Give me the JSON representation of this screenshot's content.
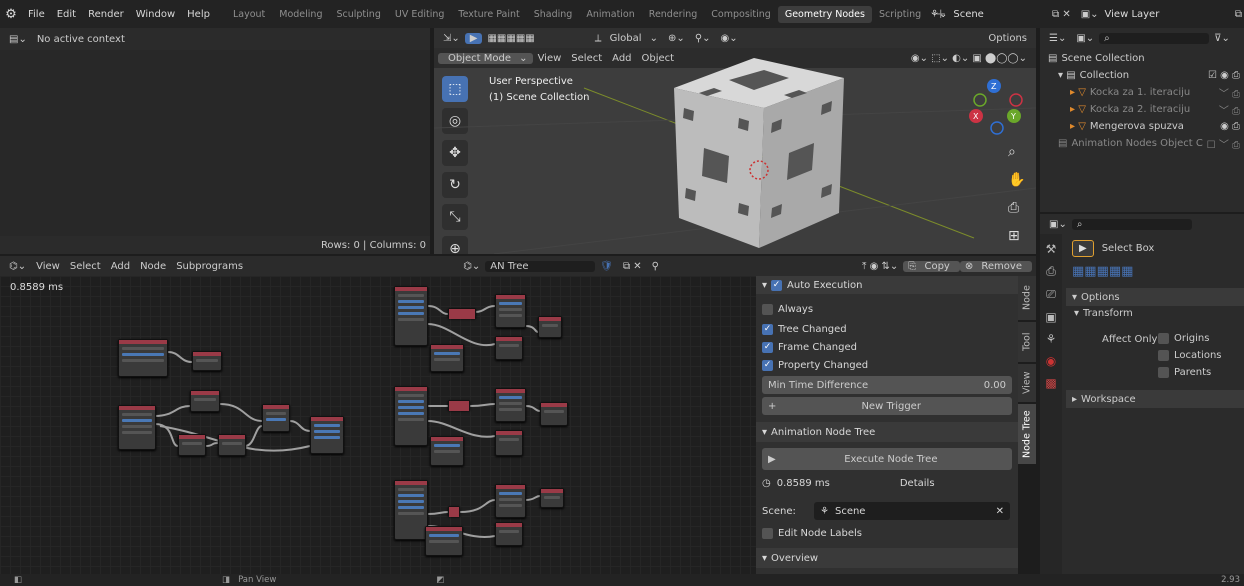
{
  "topbar": {
    "menus": [
      "File",
      "Edit",
      "Render",
      "Window",
      "Help"
    ],
    "workspaces": [
      "Layout",
      "Modeling",
      "Sculpting",
      "UV Editing",
      "Texture Paint",
      "Shading",
      "Animation",
      "Rendering",
      "Compositing",
      "Geometry Nodes",
      "Scripting"
    ],
    "active_workspace": "Geometry Nodes",
    "add_tab": "+",
    "scene": "Scene",
    "view_layer": "View Layer"
  },
  "spreadsheet": {
    "header": "No active context",
    "rows_cols": "Rows: 0  |  Columns: 0"
  },
  "viewport": {
    "mode": "Object Mode",
    "menus": [
      "View",
      "Select",
      "Add",
      "Object"
    ],
    "transform": "Global",
    "options": "Options",
    "title": "User Perspective",
    "subtitle": "(1) Scene Collection"
  },
  "node_editor": {
    "menus": [
      "View",
      "Select",
      "Add",
      "Node",
      "Subprograms"
    ],
    "tree_name": "AN Tree",
    "timing": "0.8589 ms",
    "copy": "Copy",
    "remove": "Remove"
  },
  "sidebar": {
    "auto_execution": "Auto Execution",
    "always": "Always",
    "tree_changed": "Tree Changed",
    "frame_changed": "Frame Changed",
    "property_changed": "Property Changed",
    "min_time_label": "Min Time Difference",
    "min_time_value": "0.00",
    "new_trigger": "New Trigger",
    "animation_node_tree": "Animation Node Tree",
    "execute": "Execute Node Tree",
    "exec_time": "0.8589 ms",
    "details": "Details",
    "scene_label": "Scene:",
    "scene_value": "Scene",
    "edit_labels": "Edit Node Labels",
    "overview": "Overview",
    "tabs": [
      "Node",
      "Tool",
      "View",
      "Node Tree"
    ]
  },
  "outliner": {
    "scene_collection": "Scene Collection",
    "collection": "Collection",
    "items": [
      "Kocka za 1. iteraciju",
      "Kocka za 2. iteraciju",
      "Mengerova spuzva"
    ],
    "anim_obj": "Animation Nodes Object C"
  },
  "properties": {
    "select_box": "Select Box",
    "options": "Options",
    "transform": "Transform",
    "affect_only": "Affect Only",
    "origins": "Origins",
    "locations": "Locations",
    "parents": "Parents",
    "workspace": "Workspace"
  },
  "status": {
    "pan": "Pan View",
    "version": "2.93"
  }
}
